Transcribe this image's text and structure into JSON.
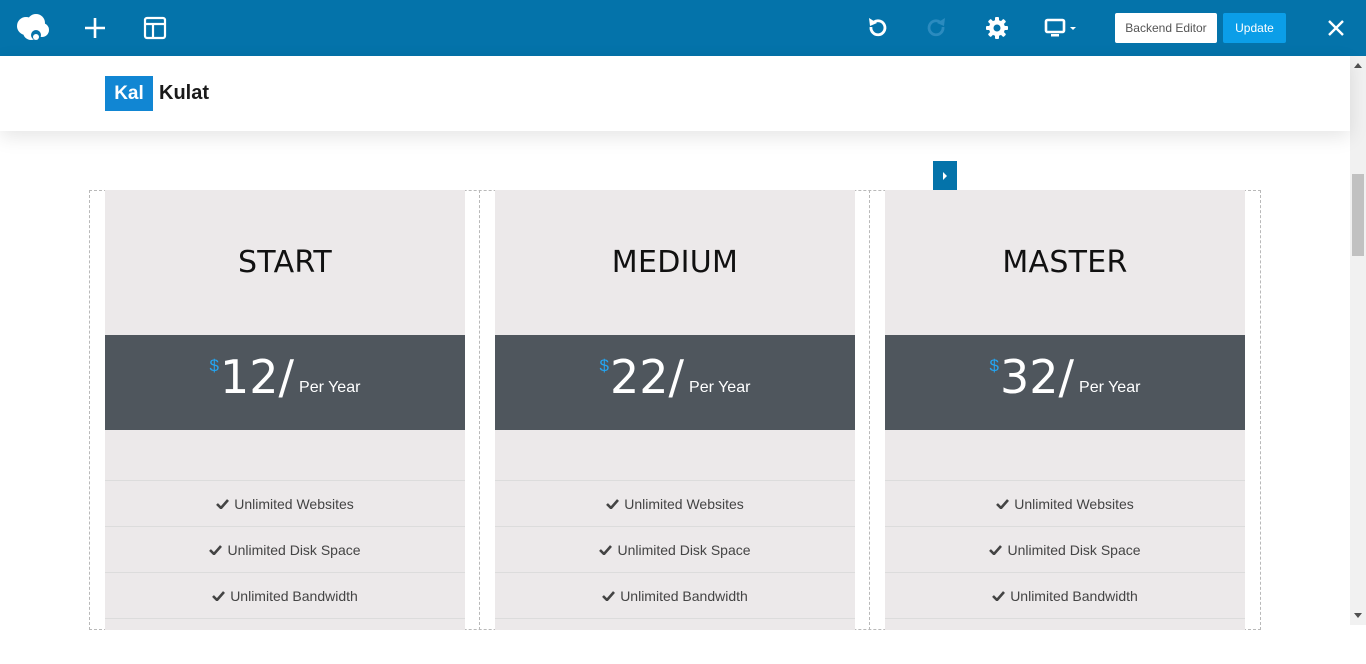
{
  "toolbar": {
    "logo_icon": "cloud-logo-icon",
    "add_icon": "plus-icon",
    "layout_icon": "layout-icon",
    "undo_icon": "undo-icon",
    "redo_icon": "redo-icon",
    "settings_icon": "gear-icon",
    "device_icon": "desktop-icon",
    "close_icon": "close-icon",
    "backend_editor_label": "Backend Editor",
    "update_label": "Update",
    "bar_color": "#0473aa",
    "update_color": "#0b9ee8"
  },
  "site": {
    "logo_box": "Kal",
    "logo_text": "Kulat",
    "brand_color": "#1186d3"
  },
  "pricing": [
    {
      "title": "START",
      "currency": "$",
      "amount": "12/",
      "period": "Per Year",
      "features": [
        "Unlimited Websites",
        "Unlimited Disk Space",
        "Unlimited Bandwidth"
      ]
    },
    {
      "title": "MEDIUM",
      "currency": "$",
      "amount": "22/",
      "period": "Per Year",
      "features": [
        "Unlimited Websites",
        "Unlimited Disk Space",
        "Unlimited Bandwidth"
      ]
    },
    {
      "title": "MASTER",
      "currency": "$",
      "amount": "32/",
      "period": "Per Year",
      "features": [
        "Unlimited Websites",
        "Unlimited Disk Space",
        "Unlimited Bandwidth"
      ]
    }
  ]
}
